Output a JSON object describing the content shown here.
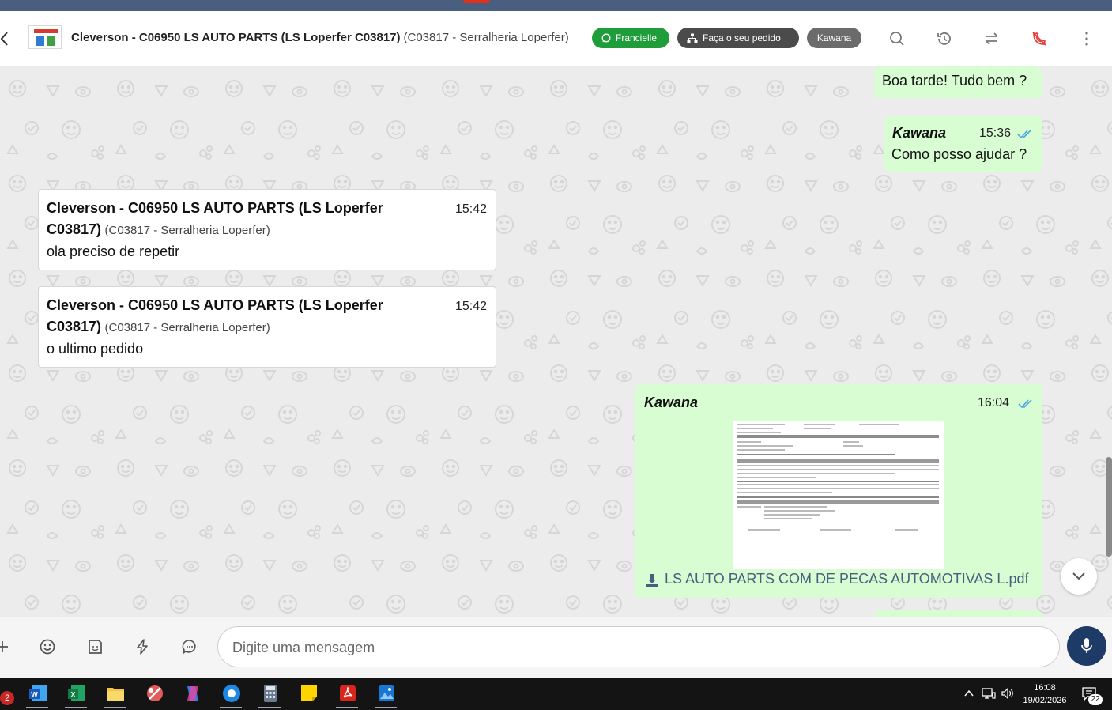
{
  "header": {
    "contact_name": "Cleverson - C06950 LS AUTO PARTS (LS Loperfer C03817)",
    "contact_sub": "(C03817 - Serralheria Loperfer)",
    "tag_agent": "Francielle",
    "tag_order": "Faça o seu pedido",
    "tag_user": "Kawana"
  },
  "messages": {
    "m1_text": "Boa tarde! Tudo bem ?",
    "m2_author": "Kawana",
    "m2_time": "15:36",
    "m2_text": "Como posso ajudar ?",
    "m3_name_line1": "Cleverson - C06950 LS AUTO PARTS (LS Loperfer",
    "m3_name_line2": "C03817)",
    "m3_sub": "(C03817 - Serralheria Loperfer)",
    "m3_time": "15:42",
    "m3_text": "ola preciso de repetir",
    "m4_name_line1": "Cleverson - C06950 LS AUTO PARTS (LS Loperfer",
    "m4_name_line2": "C03817)",
    "m4_sub": "(C03817 - Serralheria Loperfer)",
    "m4_time": "15:42",
    "m4_text": "o ultimo pedido",
    "m5_author": "Kawana",
    "m5_time": "16:04",
    "m5_file": "LS AUTO PARTS COM DE PECAS AUTOMOTIVAS L.pdf"
  },
  "composer": {
    "placeholder": "Digite uma mensagem"
  },
  "taskbar": {
    "time": "16:08",
    "date": "19/02/2026",
    "notifications": "22",
    "left_badge": "2"
  },
  "colors": {
    "outgoing_bubble": "#d9fdd3",
    "whatsapp_tag": "#1f9d3a",
    "mic_button": "#1e3a66",
    "read_ticks": "#4fa3e0"
  }
}
